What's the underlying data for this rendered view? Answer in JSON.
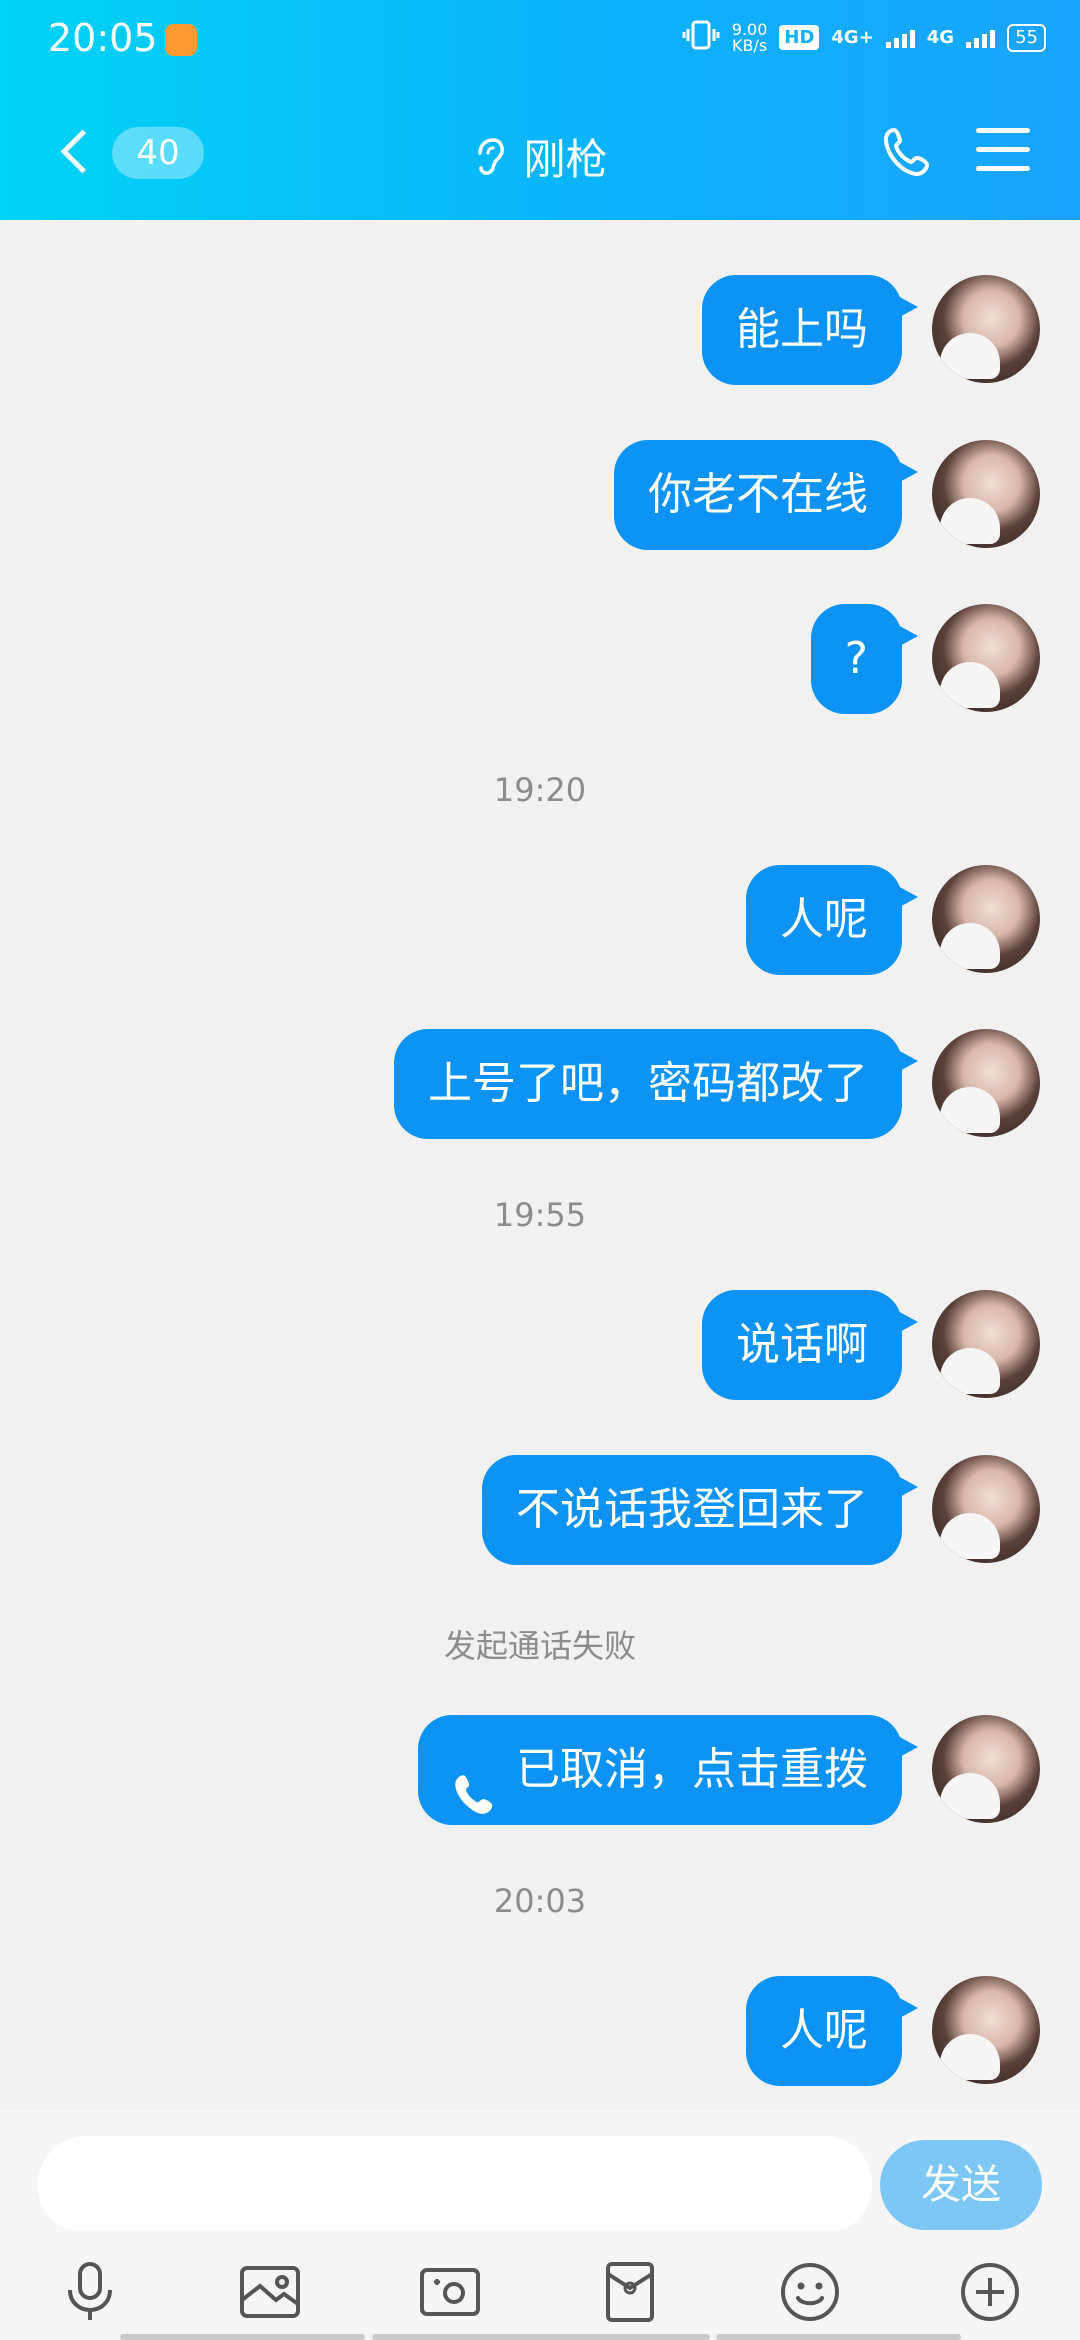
{
  "status_bar": {
    "time": "20:05",
    "speed_value": "9.00",
    "speed_unit": "KB/s",
    "hd_label": "HD",
    "network1": "4G+",
    "network2": "4G",
    "battery": "55"
  },
  "header": {
    "unread_count": "40",
    "title": "刚枪"
  },
  "messages": [
    {
      "type": "bubble",
      "text": "能上吗"
    },
    {
      "type": "bubble",
      "text": "你老不在线"
    },
    {
      "type": "bubble",
      "text": "?"
    },
    {
      "type": "time",
      "text": "19:20"
    },
    {
      "type": "bubble",
      "text": "人呢"
    },
    {
      "type": "bubble",
      "text": "上号了吧，密码都改了"
    },
    {
      "type": "time",
      "text": "19:55"
    },
    {
      "type": "bubble",
      "text": "说话啊"
    },
    {
      "type": "bubble",
      "text": "不说话我登回来了"
    },
    {
      "type": "system",
      "text": "发起通话失败"
    },
    {
      "type": "call",
      "text": "已取消，点击重拨"
    },
    {
      "type": "time",
      "text": "20:03"
    },
    {
      "type": "bubble",
      "text": "人呢"
    }
  ],
  "input": {
    "placeholder": "",
    "send_label": "发送"
  },
  "toolbar_icons": [
    "microphone-icon",
    "image-icon",
    "camera-icon",
    "red-packet-icon",
    "emoji-icon",
    "plus-icon"
  ],
  "colors": {
    "header_start": "#00d3f5",
    "header_end": "#1aa3ff",
    "bubble": "#0d93f5",
    "send_button": "#7cc7f6"
  }
}
